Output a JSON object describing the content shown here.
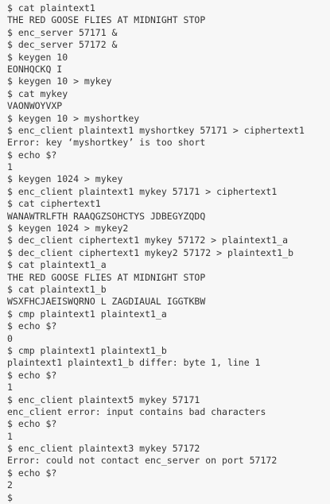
{
  "terminal": {
    "lines": [
      "$ cat plaintext1",
      "THE RED GOOSE FLIES AT MIDNIGHT STOP",
      "$ enc_server 57171 &",
      "$ dec_server 57172 &",
      "$ keygen 10",
      "EONHQCKQ I",
      "$ keygen 10 > mykey",
      "$ cat mykey",
      "VAONWOYVXP",
      "$ keygen 10 > myshortkey",
      "$ enc_client plaintext1 myshortkey 57171 > ciphertext1",
      "Error: key ‘myshortkey’ is too short",
      "$ echo $?",
      "1",
      "$ keygen 1024 > mykey",
      "$ enc_client plaintext1 mykey 57171 > ciphertext1",
      "$ cat ciphertext1",
      "WANAWTRLFTH RAAQGZSOHCTYS JDBEGYZQDQ",
      "$ keygen 1024 > mykey2",
      "$ dec_client ciphertext1 mykey 57172 > plaintext1_a",
      "$ dec_client ciphertext1 mykey2 57172 > plaintext1_b",
      "$ cat plaintext1_a",
      "THE RED GOOSE FLIES AT MIDNIGHT STOP",
      "$ cat plaintext1_b",
      "WSXFHCJAEISWQRNO L ZAGDIAUAL IGGTKBW",
      "$ cmp plaintext1 plaintext1_a",
      "$ echo $?",
      "0",
      "$ cmp plaintext1 plaintext1_b",
      "plaintext1 plaintext1_b differ: byte 1, line 1",
      "$ echo $?",
      "1",
      "$ enc_client plaintext5 mykey 57171",
      "enc_client error: input contains bad characters",
      "$ echo $?",
      "1",
      "$ enc_client plaintext3 mykey 57172",
      "Error: could not contact enc_server on port 57172",
      "$ echo $?",
      "2",
      "$"
    ]
  },
  "colors": {
    "background": "#f7f7f7",
    "text": "#333333"
  }
}
